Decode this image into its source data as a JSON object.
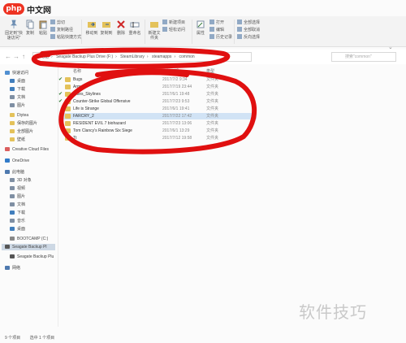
{
  "watermark_logo": {
    "php": "php",
    "site": "中文网"
  },
  "watermark_text": "软件技巧",
  "ribbon": {
    "pin_label": "固定到“快速访问”",
    "copy_label": "复制",
    "paste_label": "粘贴",
    "cut_label": "剪切",
    "copy_path_label": "复制路径",
    "paste_shortcut_label": "粘贴快捷方式",
    "move_to_label": "移动到",
    "copy_to_label": "复制到",
    "delete_label": "删除",
    "rename_label": "重命名",
    "new_folder_label": "新建文件夹",
    "new_item_label": "新建项目",
    "easy_access_label": "轻松访问",
    "properties_label": "属性",
    "open_label": "打开",
    "edit_label": "编辑",
    "history_label": "历史记录",
    "select_all_label": "全部选择",
    "select_none_label": "全部取消",
    "invert_label": "反向选择"
  },
  "address": {
    "parts": [
      "此电脑",
      "Seagate Backup Plus Drive (F:)",
      "SteamLibrary",
      "steamapps",
      "common"
    ],
    "search_placeholder": "搜索\"common\""
  },
  "sidebar": {
    "items": [
      {
        "label": "快速访问",
        "color": "#4a90d9"
      },
      {
        "label": "桌面",
        "color": "#3b7fc4"
      },
      {
        "label": "下载",
        "color": "#3b7fc4"
      },
      {
        "label": "文档",
        "color": "#7d8fa6"
      },
      {
        "label": "图片",
        "color": "#7d8fa6"
      },
      {
        "label": "Diytea",
        "color": "#e8c24f"
      },
      {
        "label": "保存的图片",
        "color": "#e8c24f"
      },
      {
        "label": "全部图片",
        "color": "#e8c24f"
      },
      {
        "label": "壁纸",
        "color": "#e8c24f"
      },
      {
        "label": "Creative Cloud Files",
        "color": "#e65b5b"
      },
      {
        "label": "OneDrive",
        "color": "#2b7cd3"
      },
      {
        "label": "此电脑",
        "color": "#4a7ab5"
      },
      {
        "label": "3D 对象",
        "color": "#7d8fa6"
      },
      {
        "label": "视频",
        "color": "#7d8fa6"
      },
      {
        "label": "图片",
        "color": "#7d8fa6"
      },
      {
        "label": "文档",
        "color": "#7d8fa6"
      },
      {
        "label": "下载",
        "color": "#3b7fc4"
      },
      {
        "label": "音乐",
        "color": "#7d8fa6"
      },
      {
        "label": "桌面",
        "color": "#3b7fc4"
      },
      {
        "label": "BOOTCAMP (C:)",
        "color": "#888888"
      },
      {
        "label": "Seagate Backup Pl",
        "color": "#555555"
      },
      {
        "label": "Seagate Backup Plu",
        "color": "#555555"
      },
      {
        "label": "网络",
        "color": "#4a7ab5"
      }
    ]
  },
  "columns": {
    "name": "名称",
    "date": "修改日期",
    "type": "类型"
  },
  "files": [
    {
      "name": "Bugs",
      "date": "2017/7/2 9:34",
      "type": "文件夹"
    },
    {
      "name": "Arma 3",
      "date": "2017/7/19 23:44",
      "type": "文件夹"
    },
    {
      "name": "Cities_Skylines",
      "date": "2017/6/1 19:48",
      "type": "文件夹"
    },
    {
      "name": "Counter-Strike Global Offensive",
      "date": "2017/7/23 9:53",
      "type": "文件夹"
    },
    {
      "name": "Life is Strange",
      "date": "2017/6/1 19:41",
      "type": "文件夹"
    },
    {
      "name": "FARCRY_2",
      "date": "2017/7/22 17:42",
      "type": "文件夹"
    },
    {
      "name": "RESIDENT EVIL 7 biohazard",
      "date": "2017/7/23 13:06",
      "type": "文件夹"
    },
    {
      "name": "Tom Clancy's Rainbow Six Siege",
      "date": "2017/6/1 13:29",
      "type": "文件夹"
    },
    {
      "name": "Tt",
      "date": "2017/7/12 19:58",
      "type": "文件夹"
    }
  ],
  "status": {
    "count": "9 个项目",
    "selected": "选中 1 个项目"
  }
}
